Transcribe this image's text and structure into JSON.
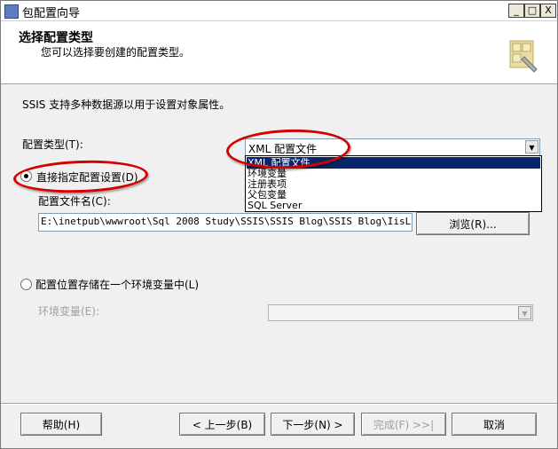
{
  "window": {
    "title": "包配置向导",
    "controls": {
      "minimize": "_",
      "maximize": "□",
      "close": "X"
    }
  },
  "header": {
    "title": "选择配置类型",
    "subtitle": "您可以选择要创建的配置类型。",
    "icon": "wizard-puzzle-icon"
  },
  "main": {
    "intro": "SSIS 支持多种数据源以用于设置对象属性。",
    "config_type_label": "配置类型(T):",
    "config_type_value": "XML 配置文件",
    "dropdown_options": [
      "XML 配置文件",
      "环境变量",
      "注册表项",
      "父包变量",
      "SQL Server"
    ],
    "direct_radio_label": "直接指定配置设置(D)",
    "filename_label": "配置文件名(C):",
    "filename_value": "E:\\inetpub\\wwwroot\\Sql 2008 Study\\SSIS\\SSIS Blog\\SSIS Blog\\IisLog.dtsConfig",
    "browse_label": "浏览(R)...",
    "env_radio_label": "配置位置存储在一个环境变量中(L)",
    "env_var_label": "环境变量(E):",
    "env_var_value": ""
  },
  "footer": {
    "help": "帮助(H)",
    "back": "< 上一步(B)",
    "next": "下一步(N) >",
    "finish": "完成(F) >>|",
    "cancel": "取消"
  },
  "colors": {
    "highlight_ellipse": "#d40000",
    "selection": "#0a246a"
  }
}
